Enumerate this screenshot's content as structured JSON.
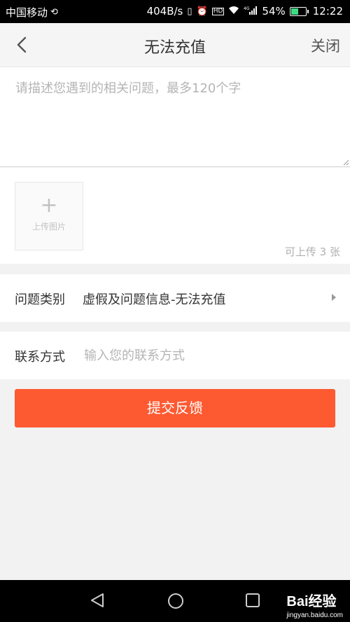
{
  "status_bar": {
    "carrier": "中国移动",
    "speed": "404B/s",
    "network": "4G",
    "battery": "54%",
    "time": "12:22"
  },
  "header": {
    "title": "无法充值",
    "close_label": "关闭"
  },
  "description": {
    "placeholder": "请描述您遇到的相关问题，最多120个字",
    "value": ""
  },
  "upload": {
    "label": "上传图片",
    "hint": "可上传 3 张"
  },
  "category": {
    "label": "问题类别",
    "value": "虚假及问题信息-无法充值"
  },
  "contact": {
    "label": "联系方式",
    "placeholder": "输入您的联系方式",
    "value": ""
  },
  "submit_label": "提交反馈",
  "watermark": {
    "brand": "Bai经验",
    "url": "jingyan.baidu.com"
  },
  "colors": {
    "accent": "#fd5a32",
    "battery": "#3ddc84"
  }
}
